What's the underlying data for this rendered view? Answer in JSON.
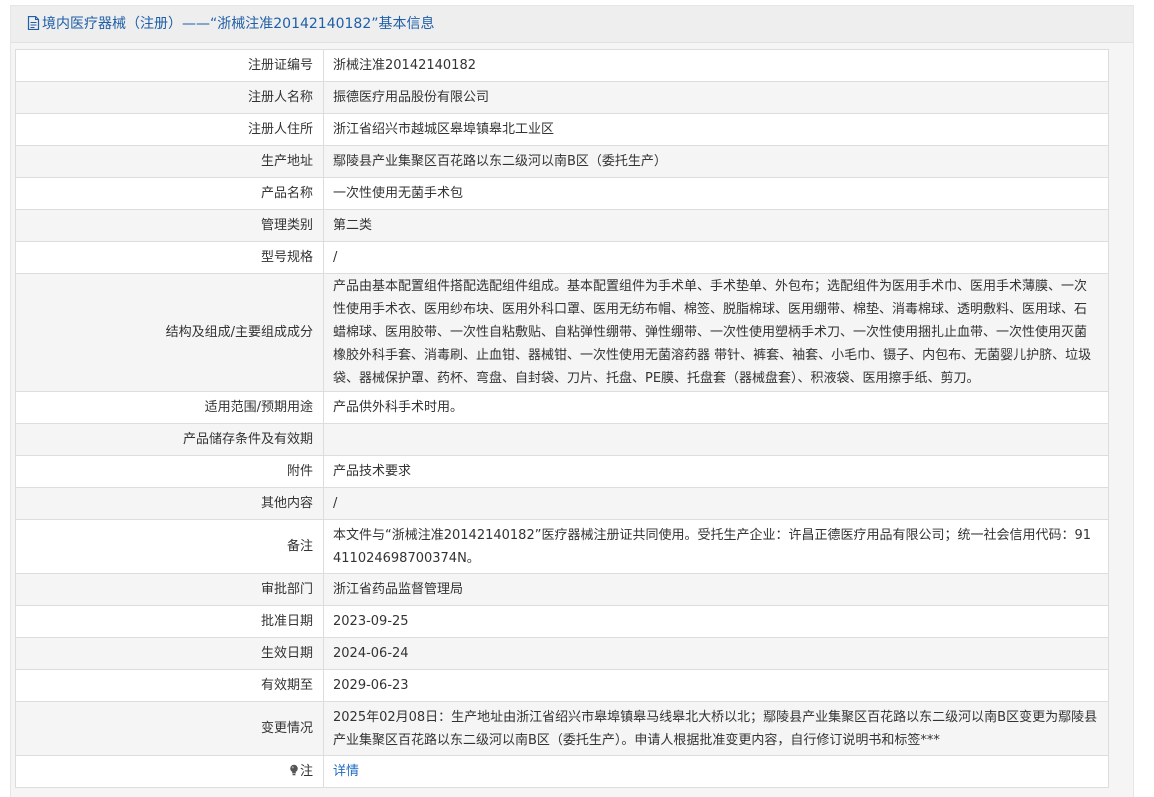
{
  "header": {
    "title": "境内医疗器械（注册）——“浙械注准20142140182”基本信息"
  },
  "rows": [
    {
      "label": "注册证编号",
      "value": "浙械注准20142140182"
    },
    {
      "label": "注册人名称",
      "value": "振德医疗用品股份有限公司"
    },
    {
      "label": "注册人住所",
      "value": "浙江省绍兴市越城区皋埠镇皋北工业区"
    },
    {
      "label": "生产地址",
      "value": "鄢陵县产业集聚区百花路以东二级河以南B区（委托生产）"
    },
    {
      "label": "产品名称",
      "value": "一次性使用无菌手术包"
    },
    {
      "label": "管理类别",
      "value": "第二类"
    },
    {
      "label": "型号规格",
      "value": "/"
    },
    {
      "label": "结构及组成/主要组成成分",
      "value": "产品由基本配置组件搭配选配组件组成。基本配置组件为手术单、手术垫单、外包布；选配组件为医用手术巾、医用手术薄膜、一次性使用手术衣、医用纱布块、医用外科口罩、医用无纺布帽、棉签、脱脂棉球、医用绷带、棉垫、消毒棉球、透明敷料、医用球、石蜡棉球、医用胶带、一次性自粘敷贴、自粘弹性绷带、弹性绷带、一次性使用塑柄手术刀、一次性使用捆扎止血带、一次性使用灭菌橡胶外科手套、消毒刷、止血钳、器械钳、一次性使用无菌溶药器 带针、裤套、袖套、小毛巾、镊子、内包布、无菌婴儿护脐、垃圾袋、器械保护罩、药杯、弯盘、自封袋、刀片、托盘、PE膜、托盘套（器械盘套）、积液袋、医用擦手纸、剪刀。"
    },
    {
      "label": "适用范围/预期用途",
      "value": "产品供外科手术时用。"
    },
    {
      "label": "产品储存条件及有效期",
      "value": ""
    },
    {
      "label": "附件",
      "value": "产品技术要求"
    },
    {
      "label": "其他内容",
      "value": "/"
    },
    {
      "label": "备注",
      "value": "本文件与“浙械注准20142140182”医疗器械注册证共同使用。受托生产企业：许昌正德医疗用品有限公司；统一社会信用代码：91411024698700374N。"
    },
    {
      "label": "审批部门",
      "value": "浙江省药品监督管理局"
    },
    {
      "label": "批准日期",
      "value": "2023-09-25"
    },
    {
      "label": "生效日期",
      "value": "2024-06-24"
    },
    {
      "label": "有效期至",
      "value": "2029-06-23"
    },
    {
      "label": "变更情况",
      "value": "2025年02月08日：生产地址由浙江省绍兴市皋埠镇皋马线皋北大桥以北；鄢陵县产业集聚区百花路以东二级河以南B区变更为鄢陵县产业集聚区百花路以东二级河以南B区（委托生产）。申请人根据批准变更内容，自行修订说明书和标签***"
    }
  ],
  "note_row": {
    "label": "注",
    "link_text": "详情",
    "icon": "lightbulb-icon"
  },
  "colors": {
    "header_text": "#1f5fa8",
    "link": "#1f6cc4",
    "border": "#dddddd",
    "alt_row": "#f5f5f5"
  }
}
